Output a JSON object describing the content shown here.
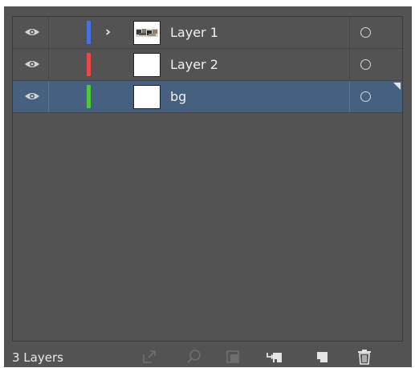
{
  "panel": {
    "layers": [
      {
        "name": "Layer 1",
        "color": "#4a6fe0",
        "expandable": true,
        "thumbnail": "image-thumbnail",
        "visible": true,
        "selected": false
      },
      {
        "name": "Layer 2",
        "color": "#e84848",
        "expandable": false,
        "thumbnail": "blank-thumbnail",
        "visible": true,
        "selected": false
      },
      {
        "name": "bg",
        "color": "#4ec93a",
        "expandable": false,
        "thumbnail": "blank-thumbnail",
        "visible": true,
        "selected": true
      }
    ],
    "footer": {
      "layer_count": "3 Layers",
      "icons": [
        "export-icon",
        "locate-object-icon",
        "clipping-mask-icon",
        "new-sublayer-icon",
        "new-layer-icon",
        "delete-icon"
      ]
    }
  }
}
